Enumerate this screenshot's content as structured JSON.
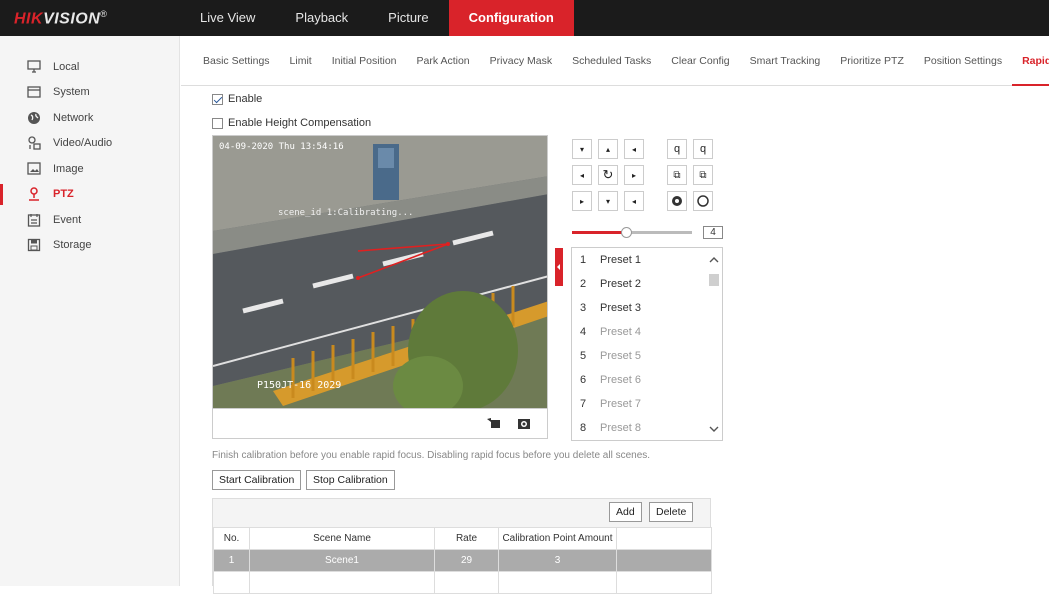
{
  "brand": {
    "logo_red": "HIK",
    "logo_white": "VISION",
    "logo_mark": "®",
    "accent": "#d9232a"
  },
  "topnav": [
    {
      "label": "Live View"
    },
    {
      "label": "Playback"
    },
    {
      "label": "Picture"
    },
    {
      "label": "Configuration",
      "active": true
    }
  ],
  "sidebar": [
    {
      "label": "Local",
      "icon": "monitor-icon"
    },
    {
      "label": "System",
      "icon": "system-icon"
    },
    {
      "label": "Network",
      "icon": "globe-icon"
    },
    {
      "label": "Video/Audio",
      "icon": "video-audio-icon"
    },
    {
      "label": "Image",
      "icon": "image-icon"
    },
    {
      "label": "PTZ",
      "icon": "ptz-icon",
      "active": true
    },
    {
      "label": "Event",
      "icon": "calendar-icon"
    },
    {
      "label": "Storage",
      "icon": "storage-icon"
    }
  ],
  "subtabs": [
    {
      "label": "Basic Settings"
    },
    {
      "label": "Limit"
    },
    {
      "label": "Initial Position"
    },
    {
      "label": "Park Action"
    },
    {
      "label": "Privacy Mask"
    },
    {
      "label": "Scheduled Tasks"
    },
    {
      "label": "Clear Config"
    },
    {
      "label": "Smart Tracking"
    },
    {
      "label": "Prioritize PTZ"
    },
    {
      "label": "Position Settings"
    },
    {
      "label": "Rapid Focus",
      "active": true
    }
  ],
  "options": {
    "enable_label": "Enable",
    "enable_checked": true,
    "height_comp_label": "Enable Height Compensation",
    "height_comp_checked": false
  },
  "video": {
    "osd_datetime": "04-09-2020 Thu 13:54:16",
    "osd_status": "scene_id 1:Calibrating...",
    "osd_plate": "P150JT-16 2029"
  },
  "ptz": {
    "speed": "4",
    "speed_fraction": 0.45
  },
  "presets": [
    {
      "num": "1",
      "name": "Preset 1",
      "enabled": true
    },
    {
      "num": "2",
      "name": "Preset 2",
      "enabled": true
    },
    {
      "num": "3",
      "name": "Preset 3",
      "enabled": true
    },
    {
      "num": "4",
      "name": "Preset 4",
      "enabled": false
    },
    {
      "num": "5",
      "name": "Preset 5",
      "enabled": false
    },
    {
      "num": "6",
      "name": "Preset 6",
      "enabled": false
    },
    {
      "num": "7",
      "name": "Preset 7",
      "enabled": false
    },
    {
      "num": "8",
      "name": "Preset 8",
      "enabled": false
    }
  ],
  "note": "Finish calibration before you enable rapid focus. Disabling rapid focus before you delete all scenes.",
  "buttons": {
    "start": "Start Calibration",
    "stop": "Stop Calibration",
    "add": "Add",
    "delete": "Delete"
  },
  "table": {
    "headers": [
      "No.",
      "Scene Name",
      "Rate",
      "Calibration Point Amount"
    ],
    "rows": [
      [
        "1",
        "Scene1",
        "29",
        "3"
      ]
    ]
  }
}
